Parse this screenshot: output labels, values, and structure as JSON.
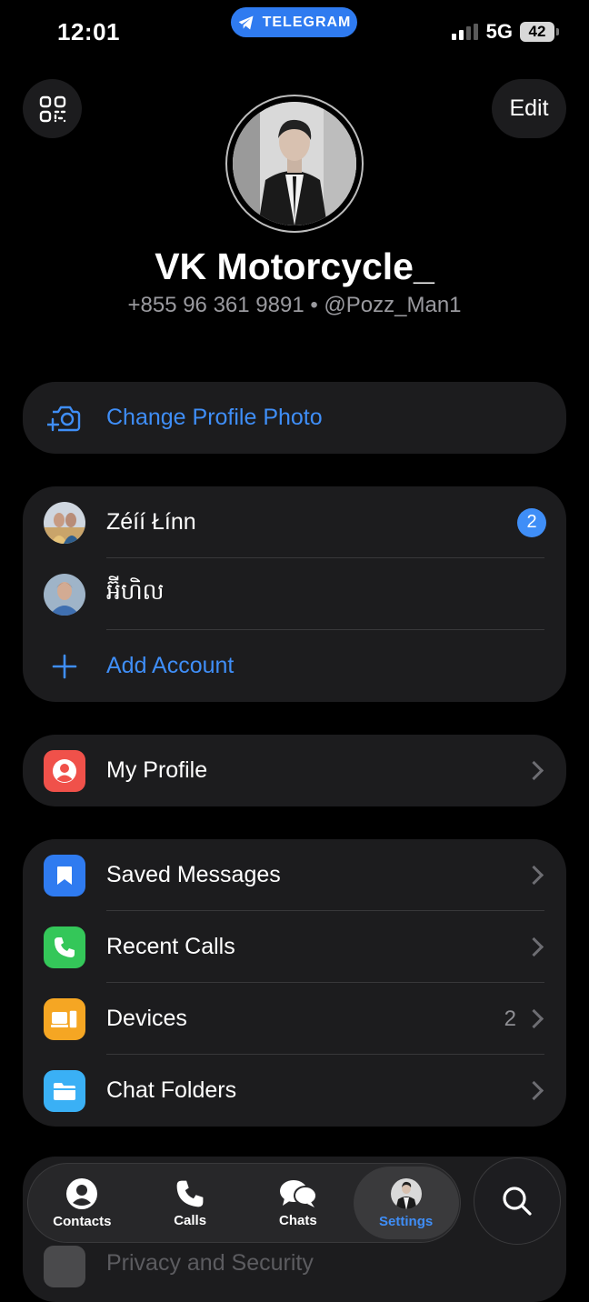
{
  "status_bar": {
    "time": "12:01",
    "app_pill": "TELEGRAM",
    "network": "5G",
    "battery": "42"
  },
  "header": {
    "edit_label": "Edit",
    "name": "VK Motorcycle_",
    "phone_username": "+855 96 361 9891 • @Pozz_Man1"
  },
  "change_photo": {
    "label": "Change Profile Photo"
  },
  "accounts": {
    "items": [
      {
        "name": "Zéíí Łínn",
        "badge": "2"
      },
      {
        "name": "អ៊ីហិល"
      }
    ],
    "add_label": "Add Account"
  },
  "my_profile": {
    "label": "My Profile"
  },
  "menu": {
    "items": [
      {
        "label": "Saved Messages",
        "icon": "bookmark-icon",
        "color": "#2f7bf0"
      },
      {
        "label": "Recent Calls",
        "icon": "phone-icon",
        "color": "#34c759"
      },
      {
        "label": "Devices",
        "icon": "devices-icon",
        "color": "#f5a623",
        "count": "2"
      },
      {
        "label": "Chat Folders",
        "icon": "folder-icon",
        "color": "#3ab0f5"
      }
    ]
  },
  "peek": {
    "label": "Privacy and Security"
  },
  "tabbar": {
    "tabs": [
      {
        "label": "Contacts"
      },
      {
        "label": "Calls"
      },
      {
        "label": "Chats"
      },
      {
        "label": "Settings"
      }
    ]
  },
  "colors": {
    "accent": "#3f8ef7",
    "card": "#1c1c1e",
    "background": "#000000"
  }
}
